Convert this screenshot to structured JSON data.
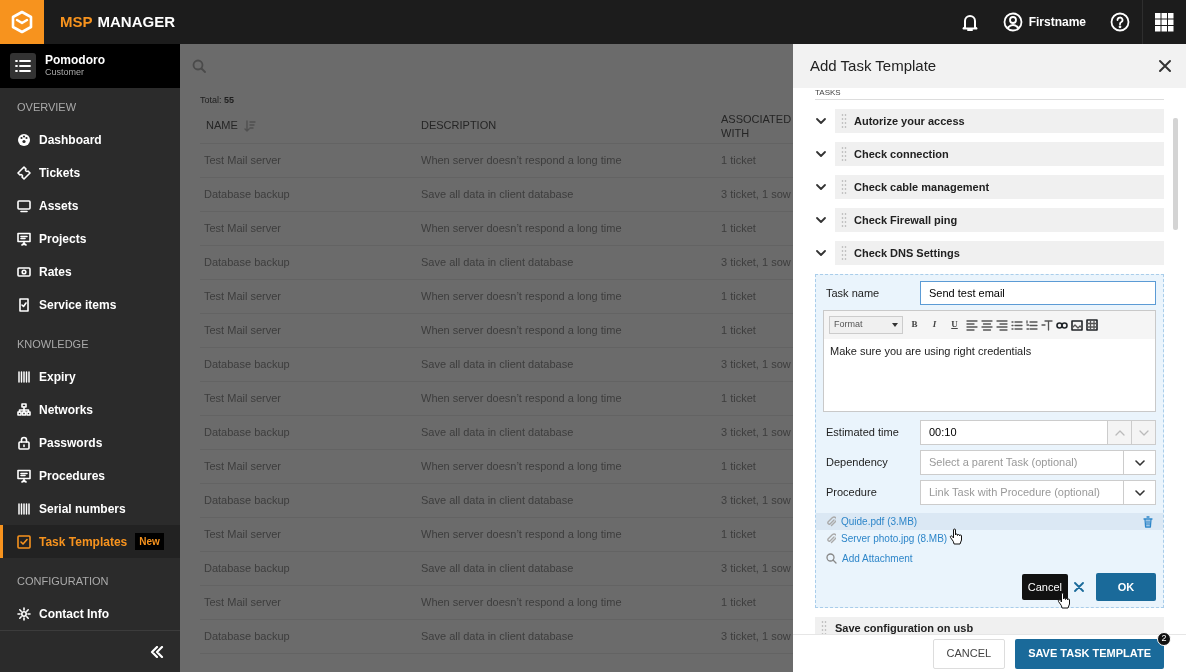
{
  "app": {
    "brand_prefix": "MSP",
    "brand_name": "MANAGER"
  },
  "topbar": {
    "user_name": "Firstname"
  },
  "customer": {
    "name": "Pomodoro",
    "role": "Customer"
  },
  "sidebar": {
    "sections": [
      {
        "title": "OVERVIEW",
        "items": [
          {
            "label": "Dashboard",
            "selected": false
          },
          {
            "label": "Tickets",
            "selected": false
          },
          {
            "label": "Assets",
            "selected": false
          },
          {
            "label": "Projects",
            "selected": false
          },
          {
            "label": "Rates",
            "selected": false
          },
          {
            "label": "Service items",
            "selected": false
          }
        ]
      },
      {
        "title": "KNOWLEDGE",
        "items": [
          {
            "label": "Expiry",
            "selected": false
          },
          {
            "label": "Networks",
            "selected": false
          },
          {
            "label": "Passwords",
            "selected": false
          },
          {
            "label": "Procedures",
            "selected": false
          },
          {
            "label": "Serial numbers",
            "selected": false
          },
          {
            "label": "Task Templates",
            "selected": true,
            "badge": "New"
          }
        ]
      },
      {
        "title": "CONFIGURATION",
        "items": [
          {
            "label": "Contact Info",
            "selected": false
          }
        ]
      }
    ]
  },
  "list": {
    "total": "Total: **55**",
    "columns": [
      "NAME",
      "DESCRIPTION",
      "ASSOCIATED WITH"
    ],
    "rows": [
      {
        "name": "Test Mail server",
        "description": "When server doesn’t respond a long time",
        "associated": "1 ticket"
      },
      {
        "name": "Database backup",
        "description": "Save all data in client database",
        "associated": "3 ticket, 1 sow"
      },
      {
        "name": "Test Mail server",
        "description": "When server doesn’t respond a long time",
        "associated": "1 ticket"
      },
      {
        "name": "Database backup",
        "description": "Save all data in client database",
        "associated": "3 ticket, 1 sow"
      },
      {
        "name": "Test Mail server",
        "description": "When server doesn’t respond a long time",
        "associated": "1 ticket"
      },
      {
        "name": "Test Mail server",
        "description": "When server doesn’t respond a long time",
        "associated": "1 ticket"
      },
      {
        "name": "Database backup",
        "description": "Save all data in client database",
        "associated": "3 ticket, 1 sow"
      },
      {
        "name": "Test Mail server",
        "description": "When server doesn’t respond a long time",
        "associated": "1 ticket"
      },
      {
        "name": "Database backup",
        "description": "Save all data in client database",
        "associated": "3 ticket, 1 sow"
      },
      {
        "name": "Test Mail server",
        "description": "When server doesn’t respond a long time",
        "associated": "1 ticket"
      },
      {
        "name": "Database backup",
        "description": "Save all data in client database",
        "associated": "3 ticket, 1 sow"
      },
      {
        "name": "Test Mail server",
        "description": "When server doesn’t respond a long time",
        "associated": "1 ticket"
      },
      {
        "name": "Database backup",
        "description": "Save all data in client database",
        "associated": "3 ticket, 1 sow"
      },
      {
        "name": "Test Mail server",
        "description": "When server doesn’t respond a long time",
        "associated": "1 ticket"
      },
      {
        "name": "Database backup",
        "description": "Save all data in client database",
        "associated": "3 ticket, 1 sow"
      }
    ]
  },
  "panel": {
    "title": "Add Task Template",
    "section_label": "TASKS",
    "tasks": [
      {
        "label": "Autorize your access"
      },
      {
        "label": "Check connection"
      },
      {
        "label": "Check cable management"
      },
      {
        "label": "Check Firewall ping"
      },
      {
        "label": "Check DNS Settings"
      }
    ],
    "form": {
      "task_name_label": "Task name",
      "task_name": "Send test email",
      "editor": {
        "format": "Format",
        "buttons": [
          "B",
          "I",
          "U"
        ],
        "content": "Make sure you are using right credentials"
      },
      "fields": [
        {
          "kind": "spinner",
          "label": "Estimated time",
          "value": "00:10"
        },
        {
          "kind": "select",
          "label": "Dependency",
          "placeholder": "Select a parent Task (optional)"
        },
        {
          "kind": "select",
          "label": "Procedure",
          "placeholder": "Link Task with Procedure (optional)"
        }
      ],
      "attachments": [
        {
          "name": "Quide.pdf (3.MB)",
          "hovered": true
        },
        {
          "name": "Server photo.jpg (8.MB)",
          "hovered": false
        }
      ],
      "add_attachment": "Add Attachment",
      "tooltip": "Cancel",
      "ok": "OK"
    },
    "next_task": "Save configuration on usb",
    "footer": {
      "cancel": "CANCEL",
      "save": "SAVE TASK TEMPLATE",
      "save_badge": "2"
    }
  }
}
